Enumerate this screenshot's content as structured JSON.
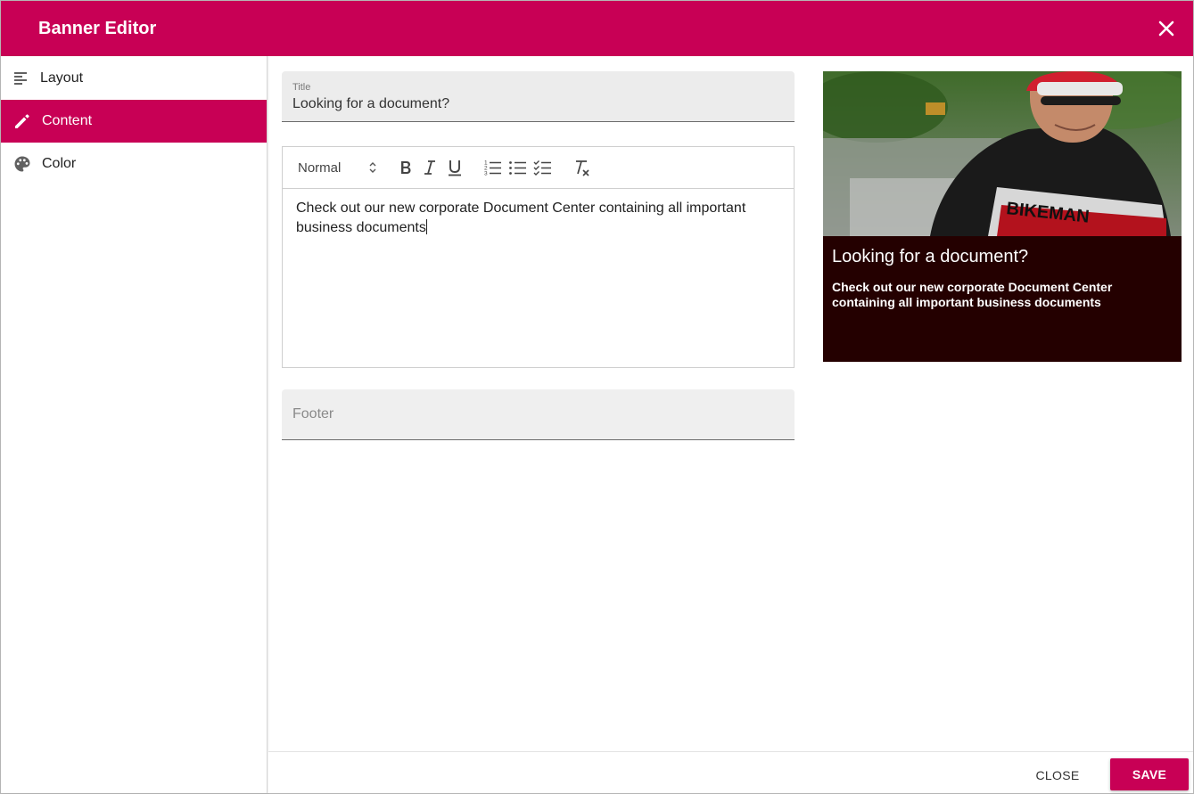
{
  "dialog": {
    "title": "Banner Editor",
    "close_icon": "close-icon",
    "accent_color": "#c80055"
  },
  "sidebar": {
    "items": [
      {
        "label": "Layout",
        "icon": "align-left-icon",
        "active": false
      },
      {
        "label": "Content",
        "icon": "pencil-icon",
        "active": true
      },
      {
        "label": "Color",
        "icon": "palette-icon",
        "active": false
      }
    ]
  },
  "form": {
    "title_label": "Title",
    "title_value": "Looking for a document?",
    "editor": {
      "format_select": "Normal",
      "toolbar_icons": [
        "bold-icon",
        "italic-icon",
        "underline-icon",
        "ordered-list-icon",
        "bullet-list-icon",
        "checklist-icon",
        "clear-format-icon"
      ],
      "body": "Check out our new corporate Document Center containing all important business documents"
    },
    "footer_placeholder": "Footer"
  },
  "preview": {
    "title": "Looking for a document?",
    "text": "Check out our new corporate Document Center containing all important business documents",
    "background_color": "#240000"
  },
  "actions": {
    "close_label": "CLOSE",
    "save_label": "SAVE"
  }
}
